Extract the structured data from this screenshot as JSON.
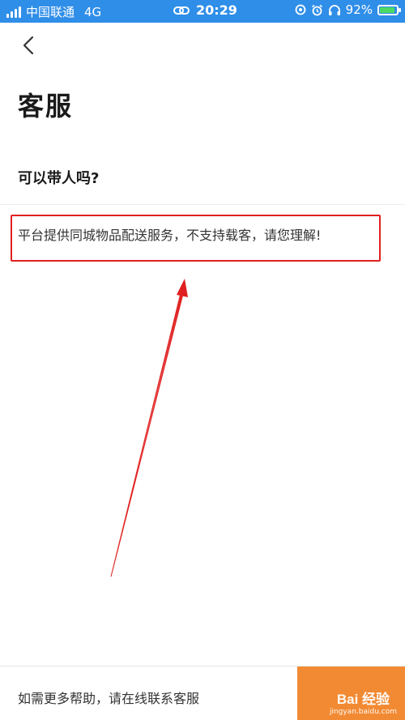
{
  "status_bar": {
    "carrier": "中国联通",
    "network": "4G",
    "time": "20:29",
    "battery": "92%",
    "battery_level": 0.92,
    "icons": [
      "signal-icon",
      "link-icon",
      "location-icon",
      "alarm-icon",
      "headphones-icon",
      "battery-icon"
    ]
  },
  "header": {
    "back_icon": "chevron-left-icon",
    "title": "客服"
  },
  "faq": {
    "question": "可以带人吗?",
    "answer": "平台提供同城物品配送服务，不支持载客，请您理解!"
  },
  "annotation": {
    "highlight_color": "#e02020"
  },
  "bottom_bar": {
    "help_text": "如需更多帮助，请在线联系客服",
    "button_color": "#f28a33",
    "watermark_main": "Bai 经验",
    "watermark_sub": "jingyan.baidu.com"
  },
  "colors": {
    "status_bar": "#2f8ee8",
    "accent": "#f28a33"
  }
}
